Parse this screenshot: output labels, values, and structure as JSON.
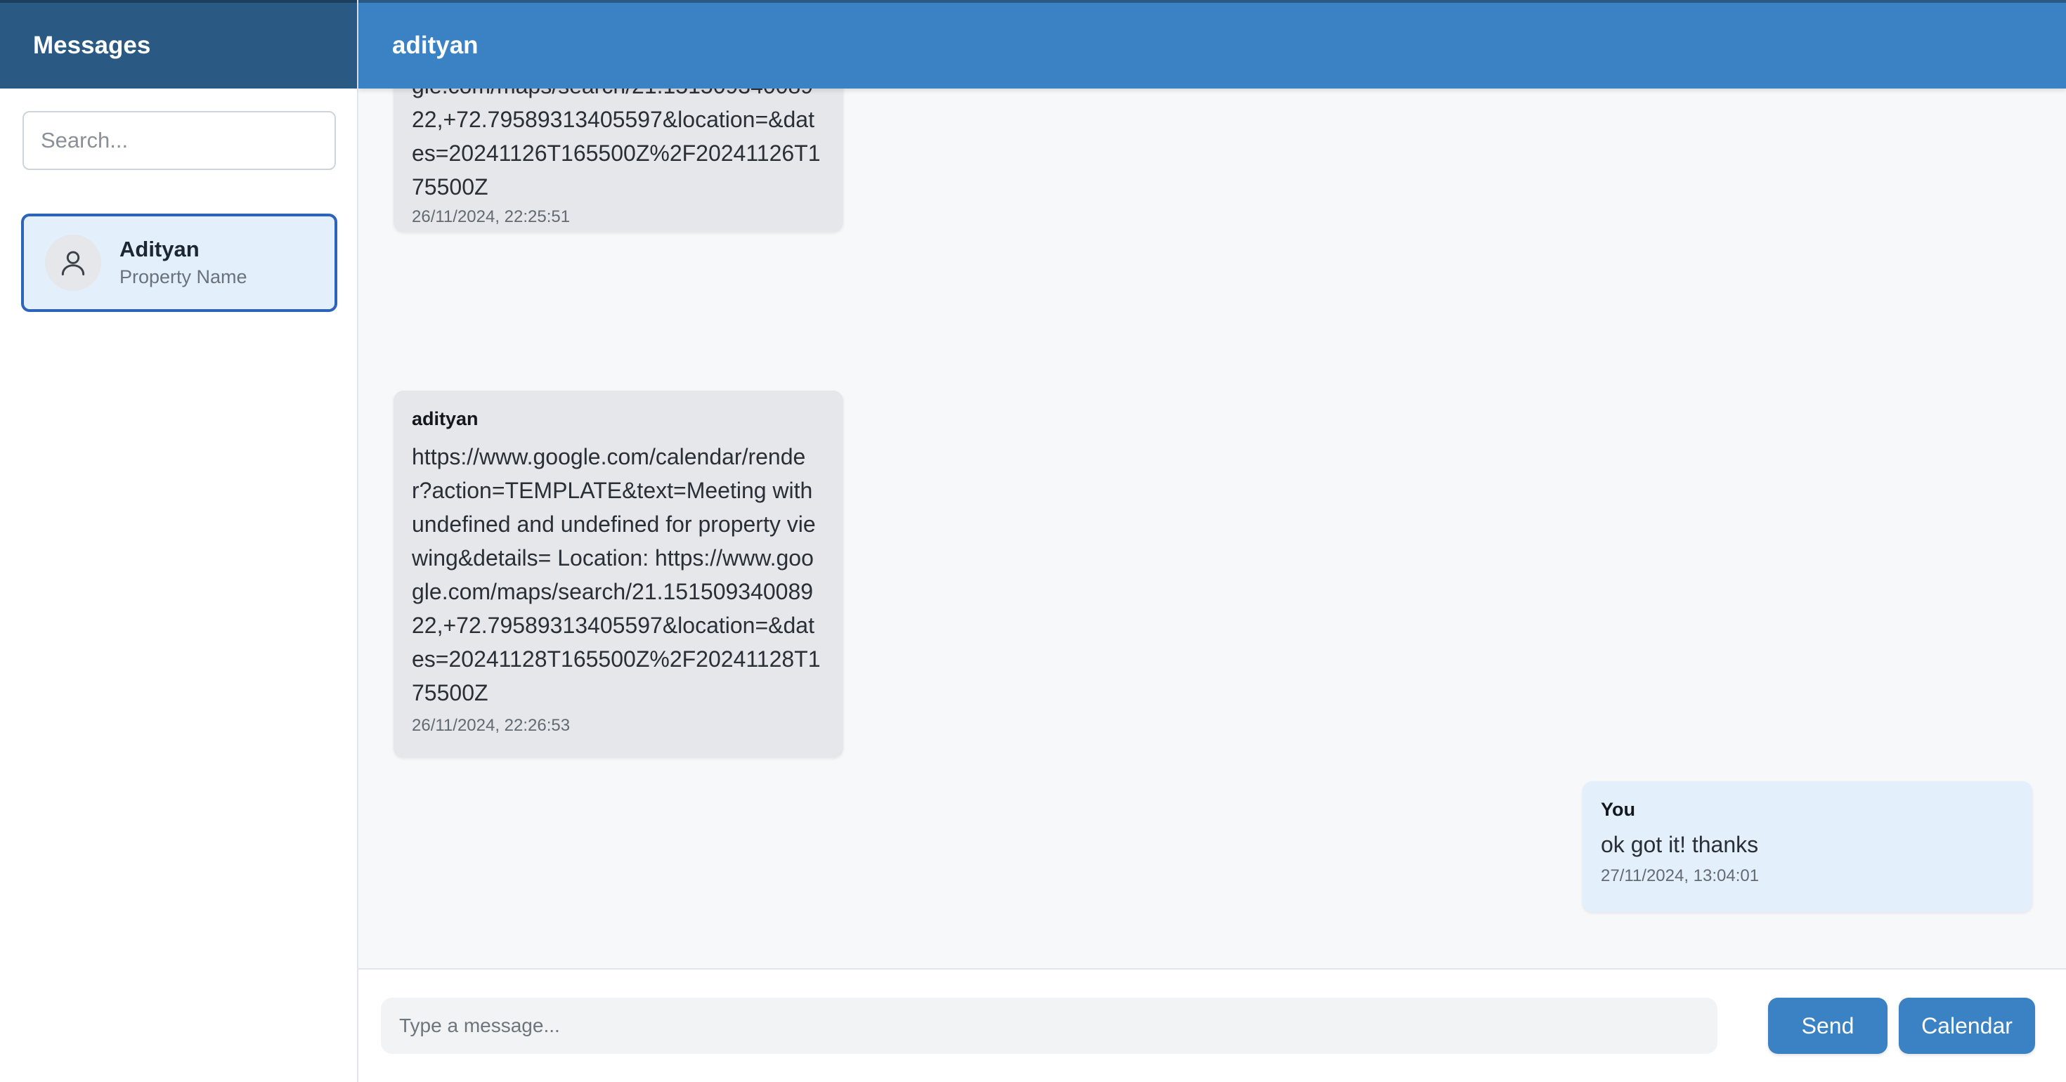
{
  "sidebar": {
    "title": "Messages",
    "search_placeholder": "Search...",
    "contacts": [
      {
        "name": "Adityan",
        "subtitle": "Property Name",
        "selected": true
      }
    ]
  },
  "chat": {
    "title": "adityan",
    "messages": [
      {
        "sender": "",
        "direction": "incoming",
        "text": "r?action=TEMPLATE&text=Meeting with undefined and undefined for property viewing&details= Location: https://www.google.com/maps/search/21.15150934008922,+72.79589313405597&location=&dates=20241126T165500Z%2F20241126T175500Z",
        "timestamp": "26/11/2024, 22:25:51"
      },
      {
        "sender": "adityan",
        "direction": "incoming",
        "text": "https://www.google.com/calendar/render?action=TEMPLATE&text=Meeting with undefined and undefined for property viewing&details= Location: https://www.google.com/maps/search/21.15150934008922,+72.79589313405597&location=&dates=20241128T165500Z%2F20241128T175500Z",
        "timestamp": "26/11/2024, 22:26:53"
      },
      {
        "sender": "You",
        "direction": "outgoing",
        "text": "ok got it! thanks",
        "timestamp": "27/11/2024, 13:04:01"
      }
    ]
  },
  "composer": {
    "placeholder": "Type a message...",
    "send_label": "Send",
    "calendar_label": "Calendar"
  },
  "colors": {
    "sidebar_header": "#2a5a84",
    "chat_header": "#3a82c3",
    "incoming_bubble": "#e6e7ea",
    "outgoing_bubble": "#e3effb",
    "selected_border": "#2d63b9",
    "button": "#3a82c3"
  },
  "icons": {
    "avatar": "user-icon"
  }
}
